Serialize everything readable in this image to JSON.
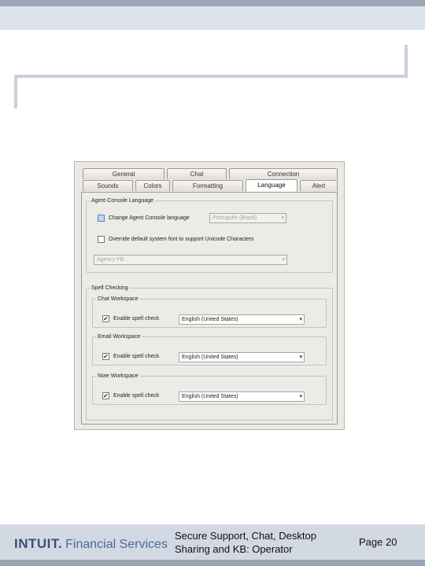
{
  "dialog": {
    "tabs_row1": [
      "General",
      "Chat",
      "Connection"
    ],
    "tabs_row2": [
      "Sounds",
      "Colors",
      "Formatting",
      "Language",
      "Alert"
    ],
    "active_tab": "Language",
    "agent_console": {
      "legend": "Agent Console Language",
      "change_language": {
        "label": "Change Agent Console language",
        "checked": false,
        "value": "Português (Brazil)"
      },
      "override_font": {
        "label": "Override default system font to support Unicode Characters",
        "checked": false
      },
      "font_select": "Agency FB"
    },
    "spell": {
      "legend": "Spell Checking",
      "chat": {
        "legend": "Chat Workspace",
        "label": "Enable spell check",
        "checked": true,
        "value": "English (United States)"
      },
      "email": {
        "legend": "Email Workspace",
        "label": "Enable spell check",
        "checked": true,
        "value": "English (United States)"
      },
      "note": {
        "legend": "Note Workspace",
        "label": "Enable spell check",
        "checked": true,
        "value": "English (United States)"
      }
    }
  },
  "footer": {
    "logo_brand": "INTUIT.",
    "logo_sub": "Financial Services",
    "title_line1": "Secure Support, Chat, Desktop",
    "title_line2": "Sharing and KB: Operator",
    "page": "Page 20"
  },
  "icons": {
    "check": "✔",
    "dropdown": "▾"
  }
}
